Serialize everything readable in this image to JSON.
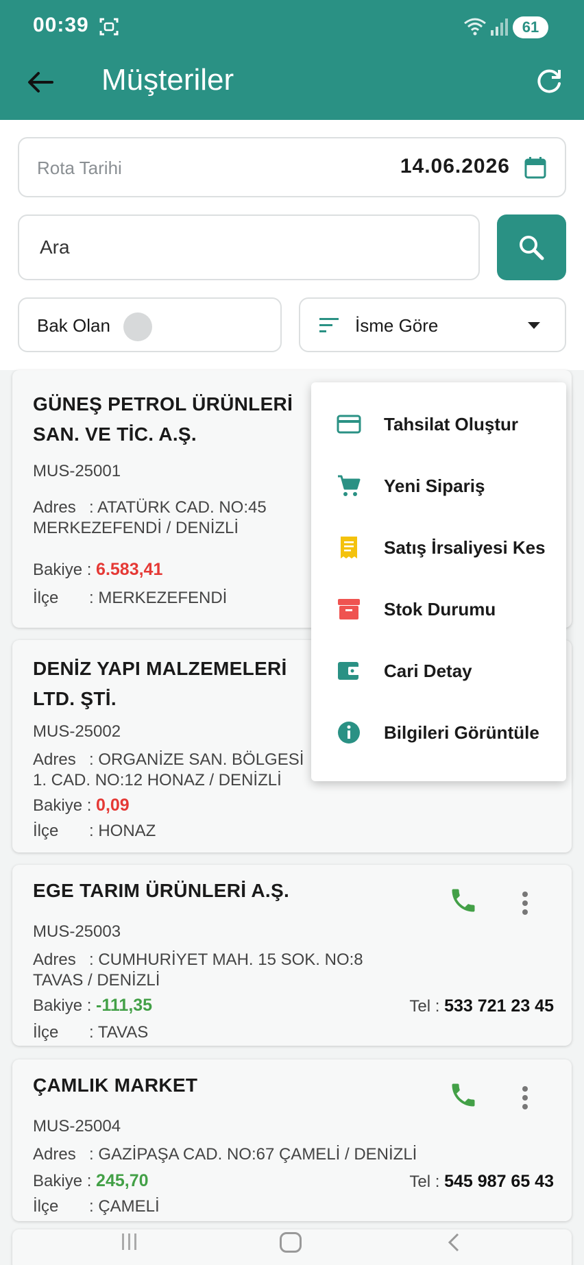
{
  "status_bar": {
    "time": "00:39",
    "battery": "61"
  },
  "header": {
    "title": "Müşteriler"
  },
  "filters": {
    "date_label": "Rota Tarihi",
    "date_value": "14.06.2026",
    "search_placeholder": "Ara",
    "bak_olan_label": "Bak Olan",
    "sort_label": "İsme Göre"
  },
  "customers": [
    {
      "name": "GÜNEŞ PETROL ÜRÜNLERİ SAN. VE TİC. A.Ş.",
      "code": "MUS-25001",
      "address_label": "Adres",
      "address": ": ATATÜRK CAD. NO:45 MERKEZEFENDİ / DENİZLİ",
      "balance_label": "Bakiye :",
      "balance": "6.583,41",
      "district_label": "İlçe",
      "district": ": MERKEZEFENDİ"
    },
    {
      "name": "DENİZ YAPI MALZEMELERİ LTD. ŞTİ.",
      "code": "MUS-25002",
      "address_label": "Adres",
      "address": ": ORGANİZE SAN. BÖLGESİ 1. CAD. NO:12 HONAZ / DENİZLİ",
      "balance_label": "Bakiye :",
      "balance": "0,09",
      "district_label": "İlçe",
      "district": ": HONAZ"
    },
    {
      "name": "EGE TARIM ÜRÜNLERİ A.Ş.",
      "code": "MUS-25003",
      "address_label": "Adres",
      "address": ": CUMHURİYET MAH. 15 SOK. NO:8 TAVAS / DENİZLİ",
      "balance_label": "Bakiye :",
      "balance": "-111,35",
      "district_label": "İlçe",
      "district": ": TAVAS",
      "tel_label": "Tel :",
      "tel": "533 721 23 45"
    },
    {
      "name": "ÇAMLIK MARKET",
      "code": "MUS-25004",
      "address_label": "Adres",
      "address": ": GAZİPAŞA CAD. NO:67 ÇAMELİ / DENİZLİ",
      "balance_label": "Bakiye :",
      "balance": "245,70",
      "district_label": "İlçe",
      "district": ": ÇAMELİ",
      "tel_label": "Tel :",
      "tel": "545 987 65 43"
    }
  ],
  "context_menu": {
    "items": [
      {
        "label": "Tahsilat Oluştur",
        "icon": "credit-card-icon",
        "color": "#2a9184"
      },
      {
        "label": "Yeni Sipariş",
        "icon": "cart-icon",
        "color": "#2a9184"
      },
      {
        "label": "Satış İrsaliyesi Kes",
        "icon": "receipt-icon",
        "color": "#f4c20d"
      },
      {
        "label": "Stok Durumu",
        "icon": "archive-icon",
        "color": "#ef5350"
      },
      {
        "label": "Cari Detay",
        "icon": "wallet-icon",
        "color": "#2a9184"
      },
      {
        "label": "Bilgileri Görüntüle",
        "icon": "info-icon",
        "color": "#2a9184"
      }
    ]
  },
  "colors": {
    "primary": "#2a9184",
    "negative_balance": "#e53935",
    "positive_balance": "#43a047"
  }
}
